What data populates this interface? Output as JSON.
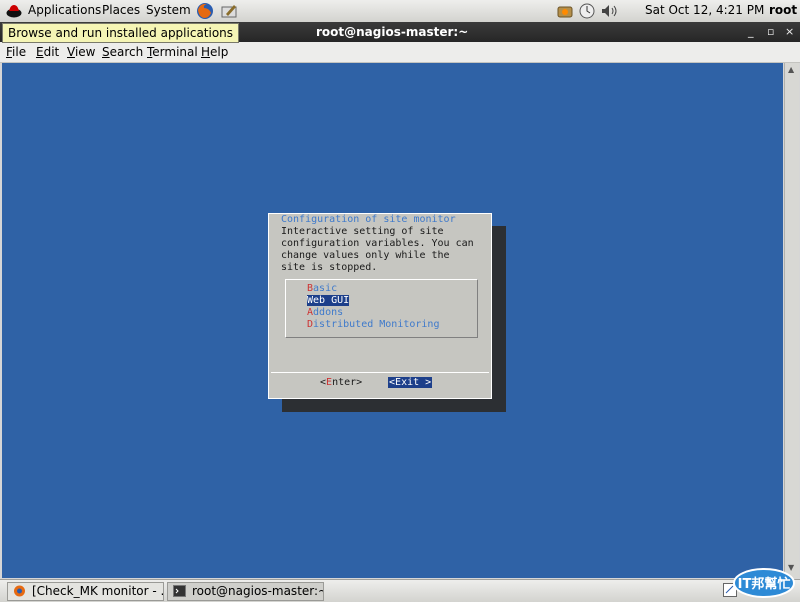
{
  "top_panel": {
    "applications": "Applications",
    "places": "Places",
    "system": "System",
    "clock": "Sat Oct 12,  4:21 PM",
    "user": "root",
    "tooltip": "Browse and run installed applications"
  },
  "window": {
    "title": "root@nagios-master:~",
    "minimize": "_",
    "maximize": "▫",
    "close": "×"
  },
  "menubar": {
    "items": [
      {
        "u": "F",
        "rest": "ile"
      },
      {
        "u": "E",
        "rest": "dit"
      },
      {
        "u": "V",
        "rest": "iew"
      },
      {
        "u": "S",
        "rest": "earch"
      },
      {
        "u": "T",
        "rest": "erminal"
      },
      {
        "u": "H",
        "rest": "elp"
      }
    ]
  },
  "dialog": {
    "title": "Configuration of site monitor",
    "message": "Interactive setting of site\nconfiguration variables. You can\nchange values only while the\nsite is stopped.",
    "menu": [
      {
        "hk": "B",
        "rest": "asic",
        "selected": false
      },
      {
        "hk": "W",
        "rest": "eb GUI",
        "selected": true
      },
      {
        "hk": "A",
        "rest": "ddons",
        "selected": false
      },
      {
        "hk": "D",
        "rest": "istributed Monitoring",
        "selected": false
      }
    ],
    "enter": {
      "pre": "<",
      "hk": "E",
      "rest": "nter>"
    },
    "exit": {
      "pre": "<",
      "hk": "E",
      "rest": "xit >"
    }
  },
  "taskbar": {
    "tasks": [
      "[Check_MK monitor - ...",
      "root@nagios-master:~"
    ]
  },
  "watermark": {
    "text": "IT邦幫忙"
  },
  "colors": {
    "terminal_bg": "#2f62a6",
    "dialog_bg": "#c6c6c1",
    "dialog_title": "#3f7acb",
    "hotkey": "#cc3333",
    "selection": "#1d3f8a"
  }
}
